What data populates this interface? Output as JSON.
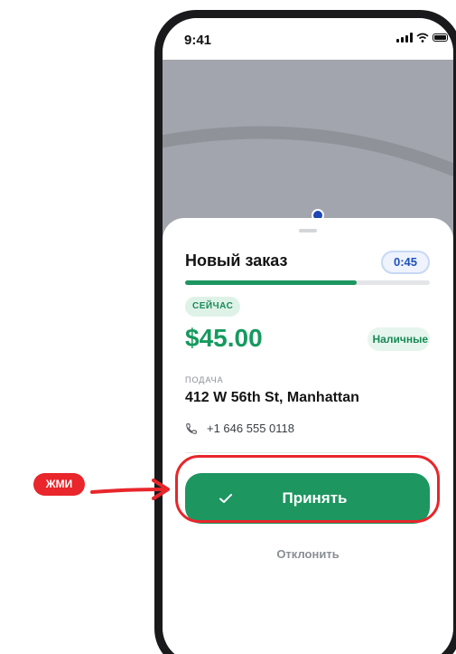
{
  "status_bar": {
    "time": "9:41",
    "icons": [
      "signal-icon",
      "wifi-icon",
      "battery-icon"
    ]
  },
  "map": {
    "marker_icon": "location-dot-icon"
  },
  "order_sheet": {
    "title": "Новый заказ",
    "timer": "0:45",
    "countdown_progress_fraction": 0.7,
    "urgency_badge": "СЕЙЧАС",
    "price": "$45.00",
    "payment_method": "Наличные",
    "pickup_label": "ПОДАЧА",
    "pickup_address": "412 W 56th St, Manhattan",
    "phone_number": "+1 646 555 0118",
    "accept_label": "Принять",
    "decline_label": "Отклонить"
  },
  "tutorial": {
    "hint_label": "ЖМИ"
  },
  "colors": {
    "accent_green": "#1d9660",
    "timer_blue": "#1d4fb8",
    "hint_red": "#e8262b",
    "map_gray": "#a2a5ad"
  }
}
